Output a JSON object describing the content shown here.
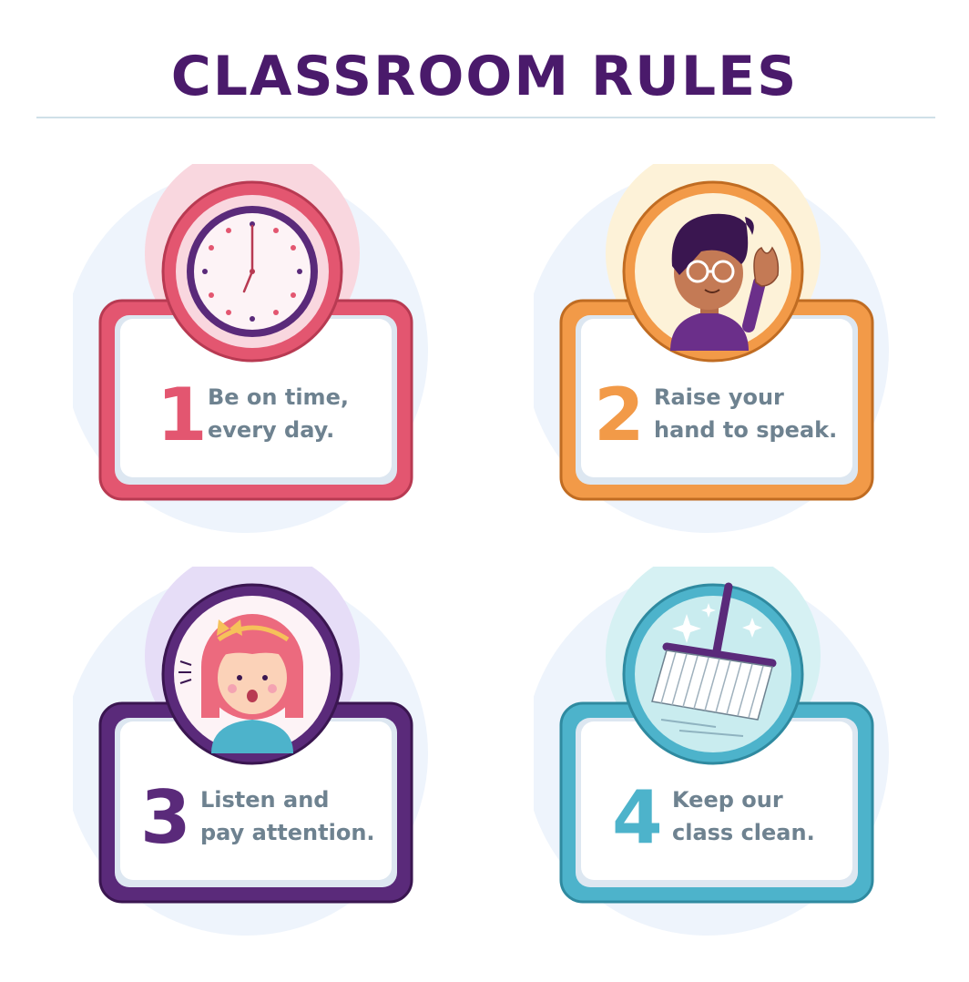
{
  "title": "CLASSROOM RULES",
  "rules": [
    {
      "number": "1",
      "line1": "Be on time,",
      "line2": "every day.",
      "icon": "clock-icon",
      "color": "#e35670",
      "accent": "#f9d7df"
    },
    {
      "number": "2",
      "line1": "Raise your",
      "line2": "hand to speak.",
      "icon": "boy-raising-hand-icon",
      "color": "#f29a48",
      "accent": "#fdf2d8"
    },
    {
      "number": "3",
      "line1": "Listen and",
      "line2": "pay attention.",
      "icon": "girl-listening-icon",
      "color": "#5a2a7a",
      "accent": "#e6ddf7"
    },
    {
      "number": "4",
      "line1": "Keep our",
      "line2": "class clean.",
      "icon": "broom-icon",
      "color": "#4db3cb",
      "accent": "#d6f1f3"
    }
  ],
  "colors": {
    "title": "#4a1a6b",
    "text": "#6e8290",
    "divider": "#cfe0e8",
    "halo": "#eef4fc"
  }
}
